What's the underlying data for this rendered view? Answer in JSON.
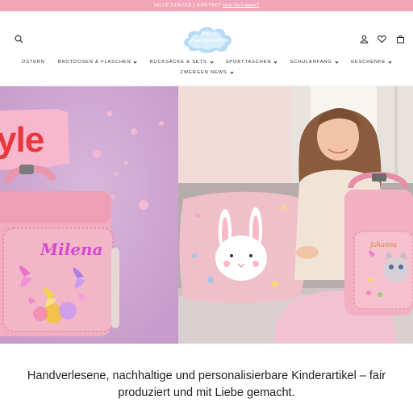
{
  "announcement": {
    "text": "HILFE CENTER | KONTAKT",
    "link": "Hast Du Fragen?"
  },
  "header": {
    "logo_line1": "Meine",
    "logo_line2": "Zwergenladen",
    "icons": [
      "search-icon",
      "account-icon",
      "heart-icon",
      "cart-icon"
    ]
  },
  "nav": {
    "row1": [
      {
        "label": "OSTERN",
        "dropdown": false
      },
      {
        "label": "BROTDOSEN & FLASCHEN",
        "dropdown": true
      },
      {
        "label": "RUCKSÄCKE & SETS",
        "dropdown": true
      },
      {
        "label": "SPORTTASCHEN",
        "dropdown": true
      },
      {
        "label": "SCHULANFANG",
        "dropdown": true
      },
      {
        "label": "GESCHENKE",
        "dropdown": true
      }
    ],
    "row2": [
      {
        "label": "ZWERGEN NEWS",
        "dropdown": true
      }
    ]
  },
  "hero": {
    "left_big_text": "yle",
    "left_bag_name": "Milena",
    "right_bag_name": "Johanna"
  },
  "tagline": "Handverlesene, nachhaltige und personalisierbare Kinderartikel – fair produziert und mit Liebe gemacht.",
  "colors": {
    "announcement_bg": "#f2a6b9",
    "hero_left_bg": "#caa2cf",
    "bag_pink": "#f3b3c4"
  }
}
